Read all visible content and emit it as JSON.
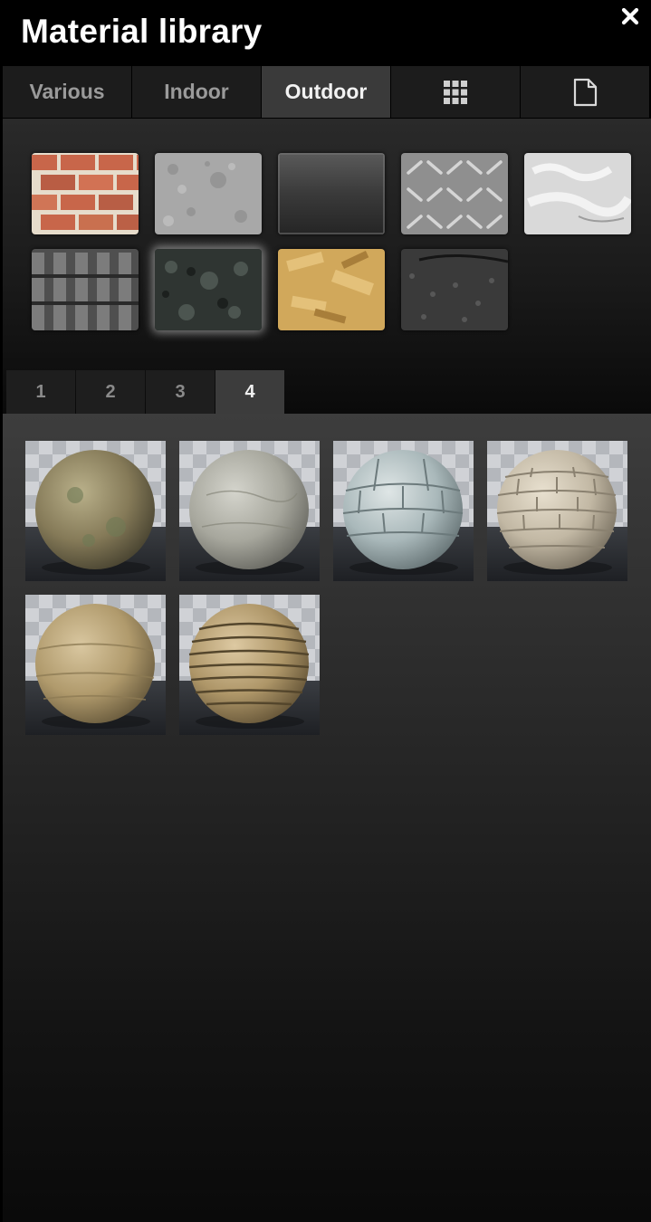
{
  "window": {
    "title": "Material library"
  },
  "icons": {
    "close": "close-icon",
    "grid": "grid-icon",
    "document": "document-icon"
  },
  "category_tabs": [
    {
      "label": "Various",
      "active": false
    },
    {
      "label": "Indoor",
      "active": false
    },
    {
      "label": "Outdoor",
      "active": true
    },
    {
      "label": "",
      "icon": "grid-icon",
      "active": false
    },
    {
      "label": "",
      "icon": "document-icon",
      "active": false
    }
  ],
  "materials": [
    {
      "name": "brick-wall",
      "selected": false
    },
    {
      "name": "concrete",
      "selected": false
    },
    {
      "name": "dark-glass",
      "selected": false
    },
    {
      "name": "diamond-plate-metal",
      "selected": false
    },
    {
      "name": "white-plaster",
      "selected": false
    },
    {
      "name": "roof-tiles",
      "selected": false
    },
    {
      "name": "dark-granite",
      "selected": true
    },
    {
      "name": "osb-wood",
      "selected": false
    },
    {
      "name": "asphalt",
      "selected": false
    }
  ],
  "page_tabs": [
    {
      "label": "1",
      "active": false
    },
    {
      "label": "2",
      "active": false
    },
    {
      "label": "3",
      "active": false
    },
    {
      "label": "4",
      "active": true
    }
  ],
  "samples": [
    {
      "name": "mossy-stone-sphere"
    },
    {
      "name": "grey-stone-sphere"
    },
    {
      "name": "blue-grey-block-sphere"
    },
    {
      "name": "beige-brick-sphere"
    },
    {
      "name": "sandstone-sphere"
    },
    {
      "name": "dry-stone-wall-sphere"
    }
  ]
}
